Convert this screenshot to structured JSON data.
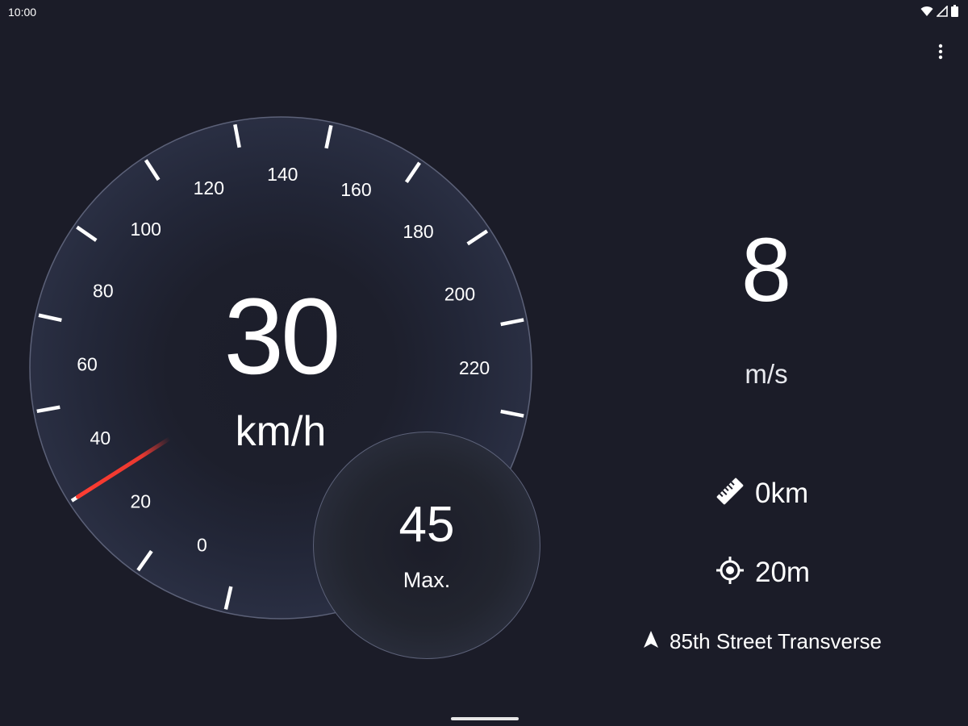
{
  "status_bar": {
    "time": "10:00",
    "icons": [
      "wifi-icon",
      "cellular-signal-icon",
      "battery-icon"
    ]
  },
  "toolbar": {
    "menu_icon": "more-vert-icon"
  },
  "speedometer": {
    "speed": "30",
    "unit": "km/h",
    "needle_value_kmh": 30,
    "needle_color": "#ff3b30",
    "dial_labels": [
      "0",
      "20",
      "40",
      "60",
      "80",
      "100",
      "120",
      "140",
      "160",
      "180",
      "200",
      "220"
    ],
    "dial_min": 0,
    "dial_max": 220
  },
  "max_speed": {
    "value": "45",
    "label": "Max."
  },
  "secondary_speed": {
    "value": "8",
    "unit": "m/s"
  },
  "distance": {
    "icon": "ruler-icon",
    "value": "0km"
  },
  "accuracy": {
    "icon": "gps-crosshair-icon",
    "value": "20m"
  },
  "location": {
    "icon": "navigation-arrow-icon",
    "street": "85th Street Transverse"
  },
  "colors": {
    "background": "#1b1c28",
    "dial_face": "#252a3b",
    "dial_rim": "#5c6178",
    "needle": "#ff3b30"
  }
}
